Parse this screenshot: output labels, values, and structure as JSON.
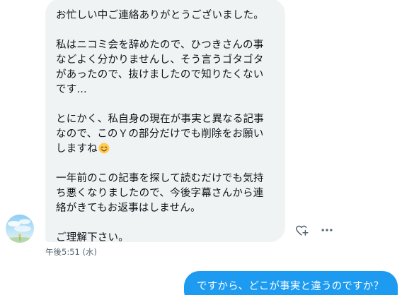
{
  "conversation": {
    "incoming": {
      "paragraphs": [
        "お忙しい中ご連絡ありがとうございました。",
        "私はニコミ会を辞めたので、ひつきさんの事\nなどよく分かりませんし、そう言うゴタゴタ\nがあったので、抜けましたので知りたくない\nです...",
        "とにかく、私自身の現在が事実と異なる記事\nなので、このＹの部分だけでも削除をお願い\nしますね",
        "一年前のこの記事を探して読むだけでも気持\nち悪くなりましたので、今後字幕さんから連\n絡がきてもお返事はしません。",
        "ご理解下さい。"
      ],
      "emoji": "smiling-face-emoji",
      "timestamp": "午後5:51 (水)"
    },
    "outgoing": {
      "text": "ですから、どこが事実と違うのですか？"
    }
  },
  "icons": {
    "react": "heart-plus-icon",
    "more": "more-dots-icon",
    "avatar": "sky-flower-avatar"
  },
  "colors": {
    "incoming_bubble": "#eff3f4",
    "outgoing_bubble": "#1d9bf0",
    "text": "#0f1419",
    "secondary_text": "#536471"
  }
}
